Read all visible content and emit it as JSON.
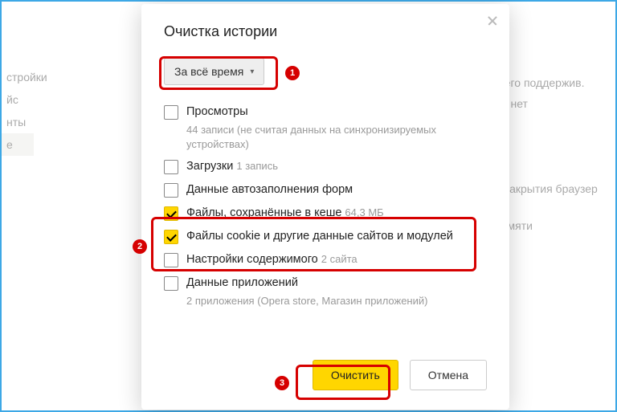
{
  "dialog": {
    "title": "Очистка истории",
    "time_range": "За всё время",
    "options": [
      {
        "key": "views",
        "checked": false,
        "label": "Просмотры",
        "sub": "",
        "subline": "44 записи (не считая данных на синхронизируемых устройствах)"
      },
      {
        "key": "downloads",
        "checked": false,
        "label": "Загрузки",
        "sub": "1 запись",
        "subline": ""
      },
      {
        "key": "autofill",
        "checked": false,
        "label": "Данные автозаполнения форм",
        "sub": "",
        "subline": ""
      },
      {
        "key": "cache",
        "checked": true,
        "label": "Файлы, сохранённые в кеше",
        "sub": "64,3 МБ",
        "subline": ""
      },
      {
        "key": "cookies",
        "checked": true,
        "label": "Файлы cookie и другие данные сайтов и модулей",
        "sub": "",
        "subline": ""
      },
      {
        "key": "content",
        "checked": false,
        "label": "Настройки содержимого",
        "sub": "2 сайта",
        "subline": ""
      },
      {
        "key": "appdata",
        "checked": false,
        "label": "Данные приложений",
        "sub": "",
        "subline": "2 приложения (Opera store, Магазин приложений)"
      }
    ],
    "buttons": {
      "primary": "Очистить",
      "secondary": "Отмена"
    }
  },
  "annotations": {
    "b1": "1",
    "b2": "2",
    "b3": "3"
  },
  "background": {
    "sidebar": [
      "стройки",
      "йс",
      "нты",
      "е"
    ],
    "right": [
      "и его поддержив.",
      "её нет",
      "",
      "",
      "",
      "",
      "",
      "е закрытия браузер",
      "",
      "намяти"
    ]
  }
}
